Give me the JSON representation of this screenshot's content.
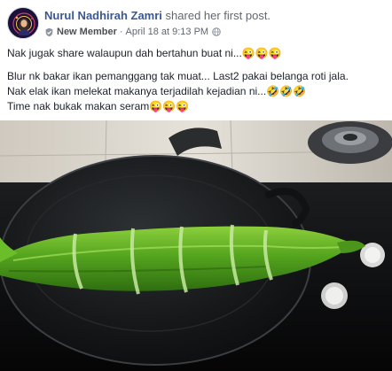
{
  "post": {
    "author_name": "Nurul Nadhirah Zamri",
    "author_action": "shared her first post.",
    "badge": "New Member",
    "date": "April 18 at 9:13 PM",
    "separator": "·",
    "lines": [
      "Nak jugak share walaupun dah bertahun buat ni...😜😜😜",
      "Blur nk bakar ikan pemanggang tak muat... Last2 pakai belanga roti jala.",
      "Nak elak ikan melekat makanya terjadilah kejadian ni...🤣🤣🤣",
      "Time nak bukak makan seram😜😜😜"
    ]
  },
  "icons": {
    "badge": "new-member-badge-icon",
    "audience": "globe-icon"
  },
  "colors": {
    "author_link": "#385898",
    "meta_text": "#616770",
    "body_text": "#1d2129"
  }
}
